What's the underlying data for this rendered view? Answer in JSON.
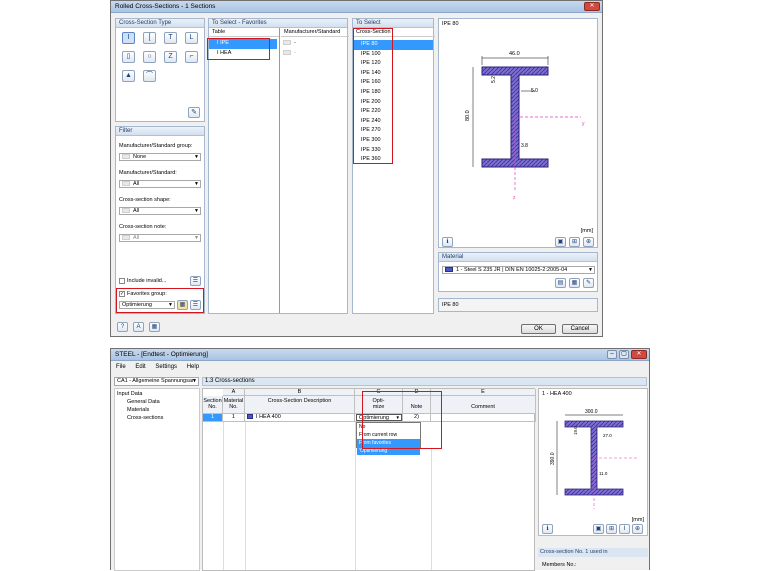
{
  "dlg": {
    "title": "Rolled Cross-Sections - 1 Sections",
    "cs_type_head": "Cross-Section Type",
    "cs_type_icons": [
      "I-section",
      "channel",
      "T-section",
      "angle",
      "rectangle",
      "circle",
      "Z-section",
      "L-section",
      "hat-section",
      "arc-section"
    ],
    "filter_head": "Filter",
    "filter": [
      {
        "label": "Manufacturer/Standard group:",
        "value": "None"
      },
      {
        "label": "Manufacturer/Standard:",
        "value": "All"
      },
      {
        "label": "Cross-section shape:",
        "value": "All"
      },
      {
        "label": "Cross-section note:",
        "value": "All"
      }
    ],
    "include_invalid": "Include invalid...",
    "favorites_group_label": "Favorites group:",
    "favorites_group_value": "Optimierung",
    "fav_head": "To Select - Favorites",
    "fav_cols": [
      "Table",
      "Manufacturer/Standard"
    ],
    "fav_rows": [
      {
        "name": "IPE",
        "std": "-"
      },
      {
        "name": "HEA",
        "std": "-"
      }
    ],
    "select_head": "To Select",
    "select_col": "Cross-Section",
    "sections": [
      "IPE 80",
      "IPE 100",
      "IPE 120",
      "IPE 140",
      "IPE 160",
      "IPE 180",
      "IPE 200",
      "IPE 220",
      "IPE 240",
      "IPE 270",
      "IPE 300",
      "IPE 330",
      "IPE 360"
    ],
    "preview_head": "IPE 80",
    "dims": {
      "b": "46.0",
      "h": "80.0",
      "tf": "5.2",
      "tw": "3.8",
      "r": "5.0",
      "y": "y",
      "z": "z"
    },
    "unit": "[mm]",
    "material_head": "Material",
    "material_value": "1 - Steel S 235 JR | DIN EN 10025-2:2005-04",
    "selected_name": "IPE 80",
    "ok": "OK",
    "cancel": "Cancel"
  },
  "app": {
    "title": "STEEL - [Endtest - Optimierung]",
    "menu": [
      "File",
      "Edit",
      "Settings",
      "Help"
    ],
    "case": "CA1 - Allgemeine Spannungsan",
    "table_title": "1.3 Cross-sections",
    "tree": {
      "root": "Input Data",
      "items": [
        "General Data",
        "Materials",
        "Cross-sections"
      ]
    },
    "col_letters": [
      "A",
      "B",
      "C",
      "D",
      "E"
    ],
    "headers": {
      "section": "Section No.",
      "material": "Material No.",
      "desc": "Cross-Section Description",
      "opt": "Opti-mize",
      "note": "Note",
      "comment": "Comment"
    },
    "row": {
      "no": "1",
      "mat": "1",
      "desc": "HEA 400",
      "opt": "Optimierung",
      "note": "2)"
    },
    "dropdown": [
      "No",
      "From current row",
      "From favorites 'Optimierung'"
    ],
    "preview_head": "1 - HEA 400",
    "dims": {
      "b": "300.0",
      "h": "390.0",
      "tf": "19.0",
      "tw": "11.0",
      "r": "27.0"
    },
    "unit": "[mm]",
    "used_head": "Cross-section No. 1 used in",
    "members": "Members No.:"
  }
}
